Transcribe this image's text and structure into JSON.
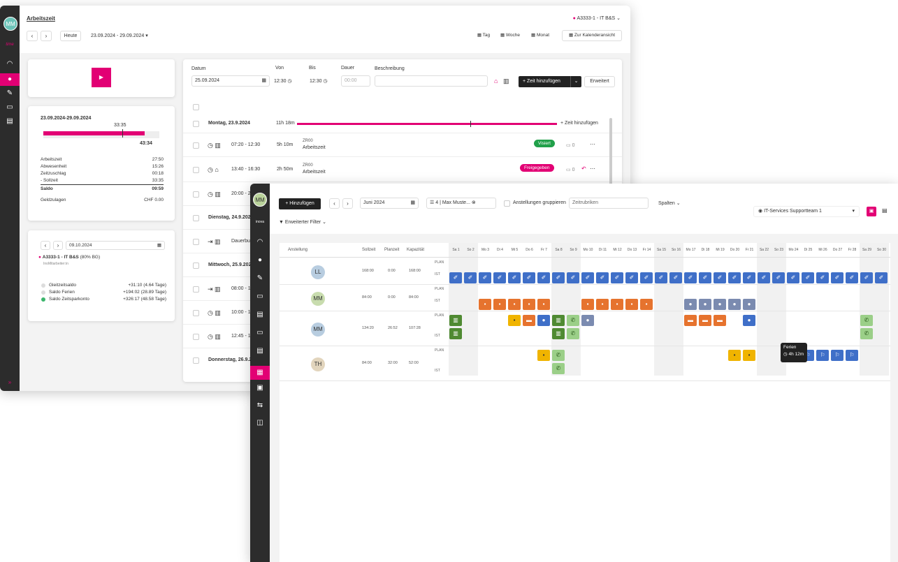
{
  "back": {
    "rail": {
      "avatar": "MM",
      "brand": "time"
    },
    "title": "Arbeitszeit",
    "org": "A3333-1 - IT B&S",
    "today": "Heute",
    "range": "23.09.2024 - 29.09.2024",
    "views": {
      "tag": "Tag",
      "woche": "Woche",
      "monat": "Monat",
      "kalender": "Zur Kalenderansicht"
    },
    "summary": {
      "range": "23.09.2024-29.09.2024",
      "top_val": "33:35",
      "bar_val": "43:34",
      "rows": [
        {
          "l": "Arbeitszeit",
          "v": "27:50"
        },
        {
          "l": "Abwesenheit",
          "v": "15:26"
        },
        {
          "l": "Zeitzuschlag",
          "v": "00:18"
        },
        {
          "l": "- Sollzeit",
          "v": "33:35"
        }
      ],
      "saldo": {
        "l": "Saldo",
        "v": "09:59"
      },
      "geld": {
        "l": "Geldzulagen",
        "v": "CHF 0.00"
      }
    },
    "card3": {
      "date": "09.10.2024",
      "org": "A3333-1 - IT B&S",
      "pct": "(80% BG)",
      "role": "InoMitarbeiter:in",
      "rows": [
        {
          "l": "Gleitzeitsaldo",
          "v": "+31:10 (4.64 Tage)"
        },
        {
          "l": "Saldo Ferien",
          "v": "+194:02 (28.89 Tage)"
        },
        {
          "l": "Saldo Zeitsparkonto",
          "v": "+326:17 (48.58 Tage)"
        }
      ]
    },
    "form": {
      "datum_l": "Datum",
      "von_l": "Von",
      "bis_l": "Bis",
      "dauer_l": "Dauer",
      "beschr_l": "Beschreibung",
      "datum": "25.09.2024",
      "von": "12:30",
      "bis": "12:30",
      "dauer": "00:00",
      "add": "+ Zeit hinzufügen",
      "erweitert": "Erweitert"
    },
    "days": [
      {
        "label": "Montag, 23.9.2024",
        "dur": "11h 18m",
        "add": "+ Zeit hinzufügen"
      },
      {
        "label": "Dienstag, 24.9.202"
      },
      {
        "label": "Mittwoch, 25.9.202"
      },
      {
        "label": "Donnerstag, 26.9.2"
      }
    ],
    "entries": [
      {
        "time": "07:20 - 12:30",
        "dur": "5h 10m",
        "code": "ZR00",
        "type": "Arbeitszeit",
        "status": "Visiert",
        "comments": "0"
      },
      {
        "time": "13:40 - 16:30",
        "dur": "2h 50m",
        "code": "ZR00",
        "type": "Arbeitszeit",
        "status": "Freigegeben",
        "comments": "0"
      },
      {
        "time": "20:00 - 2"
      },
      {
        "time": "Dauerbu"
      },
      {
        "time": "08:00 - 1"
      },
      {
        "time": "10:00 - 1"
      },
      {
        "time": "12:45 - 1"
      }
    ]
  },
  "front": {
    "rail": {
      "avatar": "MM",
      "brand": "inova"
    },
    "add": "+ Hinzufügen",
    "month": "Juni 2024",
    "filter_sel": "4 | Max Muste...",
    "group": "Anstellungen gruppieren",
    "zeitrubriken": "Zeitrubriken",
    "spalten": "Spalten",
    "team": "IT-Services Supportteam 1",
    "erw_filter": "Erweiterter Filter",
    "cols": {
      "anst": "Anstellung",
      "soll": "Sollzeit",
      "plan": "Planzeit",
      "kap": "Kapazität"
    },
    "days": [
      "Sa 1",
      "So 2",
      "Mo 3",
      "Di 4",
      "Mi 5",
      "Do 6",
      "Fr 7",
      "Sa 8",
      "So 9",
      "Mo 10",
      "Di 11",
      "Mi 12",
      "Do 13",
      "Fr 14",
      "Sa 15",
      "So 16",
      "Mo 17",
      "Di 18",
      "Mi 19",
      "Do 20",
      "Fr 21",
      "Sa 22",
      "So 23",
      "Mo 24",
      "Di 25",
      "Mi 26",
      "Do 27",
      "Fr 28",
      "Sa 29",
      "So 30"
    ],
    "people": [
      {
        "init": "LL",
        "soll": "168:00",
        "plan": "0:00",
        "kap": "168:00"
      },
      {
        "init": "MM",
        "soll": "84:00",
        "plan": "0:00",
        "kap": "84:00"
      },
      {
        "init": "MM",
        "soll": "134:20",
        "plan": "26:52",
        "kap": "107:28"
      },
      {
        "init": "TH",
        "soll": "84:00",
        "plan": "32:00",
        "kap": "52:00"
      }
    ],
    "plan_l": "PLAN",
    "ist_l": "IST",
    "tooltip": {
      "title": "Ferien",
      "dur": "4h 12m"
    }
  }
}
